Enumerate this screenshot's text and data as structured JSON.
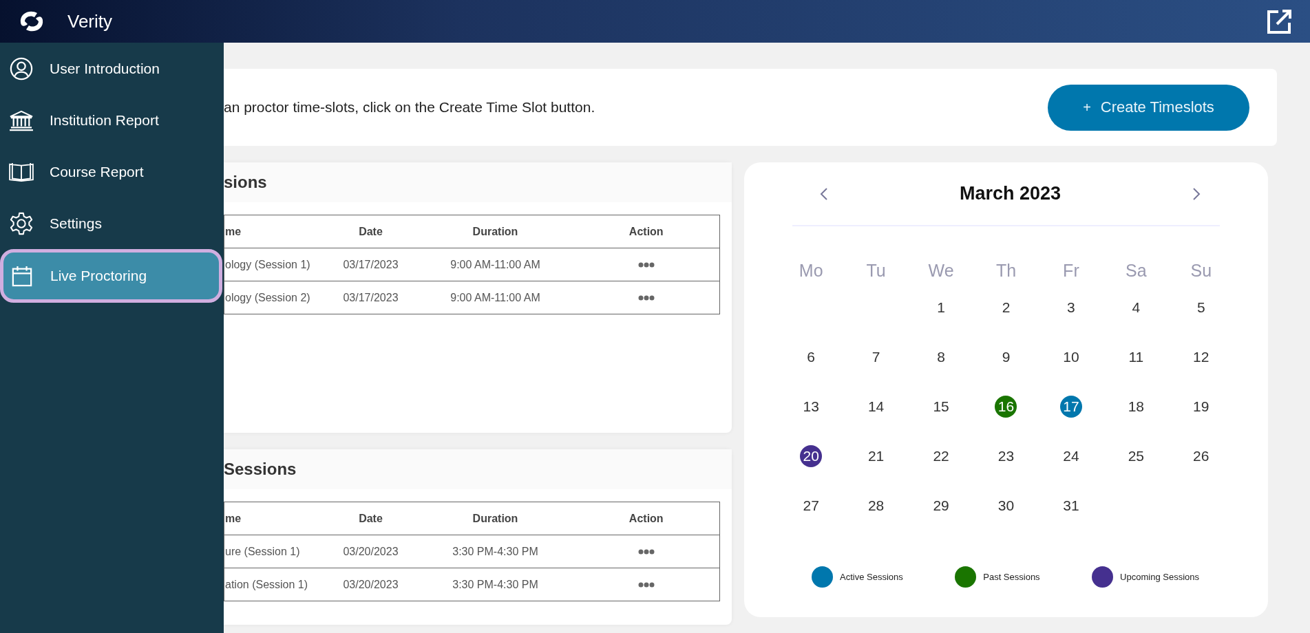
{
  "header": {
    "brand": "Verity"
  },
  "sidebar": {
    "items": [
      {
        "label": "User Introduction",
        "selected": false
      },
      {
        "label": "Institution Report",
        "selected": false
      },
      {
        "label": "Course Report",
        "selected": false
      },
      {
        "label": "Settings",
        "selected": false
      },
      {
        "label": "Live Proctoring",
        "selected": true
      }
    ]
  },
  "intro": {
    "text": "an proctor time-slots, click on the Create Time Slot button.",
    "button_symbol": "+",
    "button_label": "Create Timeslots"
  },
  "session_tables": [
    {
      "title": "sions",
      "columns": [
        "me",
        "Date",
        "Duration",
        "Action"
      ],
      "rows": [
        {
          "cells": [
            "ology (Session 1)",
            "03/17/2023",
            "9:00 AM-11:00 AM"
          ]
        },
        {
          "cells": [
            "ology (Session 2)",
            "03/17/2023",
            "9:00 AM-11:00 AM"
          ]
        }
      ]
    },
    {
      "title": "Sessions",
      "columns": [
        "me",
        "Date",
        "Duration",
        "Action"
      ],
      "rows": [
        {
          "cells": [
            "ure (Session 1)",
            "03/20/2023",
            "3:30 PM-4:30 PM"
          ]
        },
        {
          "cells": [
            "ation (Session 1)",
            "03/20/2023",
            "3:30 PM-4:30 PM"
          ]
        }
      ]
    }
  ],
  "calendar": {
    "month": "March 2023",
    "weekdays": [
      "Mo",
      "Tu",
      "We",
      "Th",
      "Fr",
      "Sa",
      "Su"
    ],
    "weeks": [
      [
        {
          "kind": "blank"
        },
        {
          "kind": "blank"
        },
        {
          "kind": "day",
          "label": "1"
        },
        {
          "kind": "day",
          "label": "2"
        },
        {
          "kind": "day",
          "label": "3"
        },
        {
          "kind": "day",
          "label": "4"
        },
        {
          "kind": "day",
          "label": "5"
        }
      ],
      [
        {
          "kind": "day",
          "label": "6"
        },
        {
          "kind": "day",
          "label": "7"
        },
        {
          "kind": "day",
          "label": "8"
        },
        {
          "kind": "day",
          "label": "9"
        },
        {
          "kind": "day",
          "label": "10"
        },
        {
          "kind": "day",
          "label": "11"
        },
        {
          "kind": "day",
          "label": "12"
        }
      ],
      [
        {
          "kind": "day",
          "label": "13"
        },
        {
          "kind": "day",
          "label": "14"
        },
        {
          "kind": "day",
          "label": "15"
        },
        {
          "kind": "day",
          "label": "16",
          "color": "#1a7500"
        },
        {
          "kind": "day",
          "label": "17",
          "color": "#0077ad"
        },
        {
          "kind": "day",
          "label": "18"
        },
        {
          "kind": "day",
          "label": "19"
        }
      ],
      [
        {
          "kind": "day",
          "label": "20",
          "color": "#45308f"
        },
        {
          "kind": "day",
          "label": "21"
        },
        {
          "kind": "day",
          "label": "22"
        },
        {
          "kind": "day",
          "label": "23"
        },
        {
          "kind": "day",
          "label": "24"
        },
        {
          "kind": "day",
          "label": "25"
        },
        {
          "kind": "day",
          "label": "26"
        }
      ],
      [
        {
          "kind": "day",
          "label": "27"
        },
        {
          "kind": "day",
          "label": "28"
        },
        {
          "kind": "day",
          "label": "29"
        },
        {
          "kind": "day",
          "label": "30"
        },
        {
          "kind": "day",
          "label": "31"
        },
        {
          "kind": "blank"
        },
        {
          "kind": "blank"
        }
      ]
    ],
    "legend": [
      {
        "label": "Active Sessions",
        "color": "#0077ad"
      },
      {
        "label": "Past Sessions",
        "color": "#1a7500"
      },
      {
        "label": "Upcoming Sessions",
        "color": "#45308f"
      }
    ]
  }
}
